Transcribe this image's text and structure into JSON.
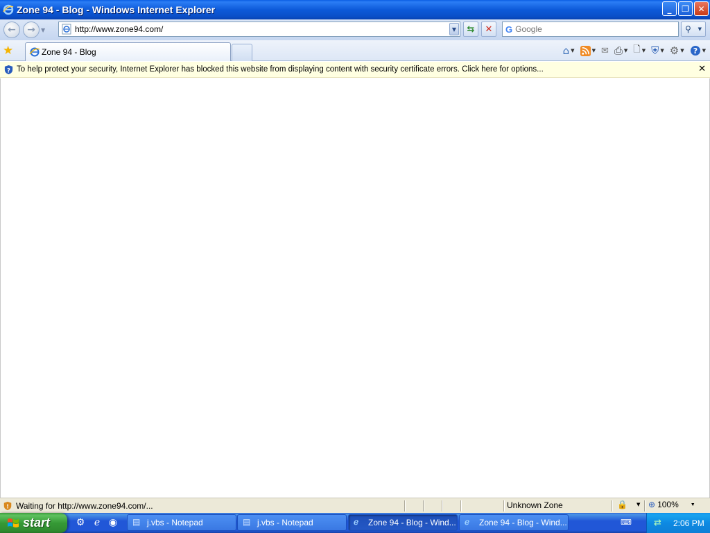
{
  "window": {
    "title": "Zone 94 - Blog - Windows Internet Explorer",
    "minimize": "_",
    "restore": "❐",
    "close": "✕"
  },
  "address": {
    "url": "http://www.zone94.com/"
  },
  "search": {
    "placeholder": "Google"
  },
  "tabs": [
    {
      "label": "Zone 94 - Blog"
    }
  ],
  "infobar": {
    "message": "To help protect your security, Internet Explorer has blocked this website from displaying content with security certificate errors. Click here for options...",
    "close": "✕"
  },
  "status": {
    "text": "Waiting for http://www.zone94.com/...",
    "zone": "Unknown Zone",
    "zoom": "100%"
  },
  "taskbar": {
    "start_label": "start",
    "tasks": [
      {
        "label": "j.vbs - Notepad",
        "icon": "notepad-icon"
      },
      {
        "label": "j.vbs - Notepad",
        "icon": "notepad-icon"
      },
      {
        "label": "Zone 94 - Blog - Wind...",
        "icon": "ie-icon"
      },
      {
        "label": "Zone 94 - Blog - Wind...",
        "icon": "ie-icon"
      }
    ],
    "clock": "2:06 PM"
  },
  "colors": {
    "titlebar": "#0a5fe4",
    "infobar": "#ffffe1",
    "start": "#3c9a3c",
    "taskbar": "#2157d7"
  }
}
